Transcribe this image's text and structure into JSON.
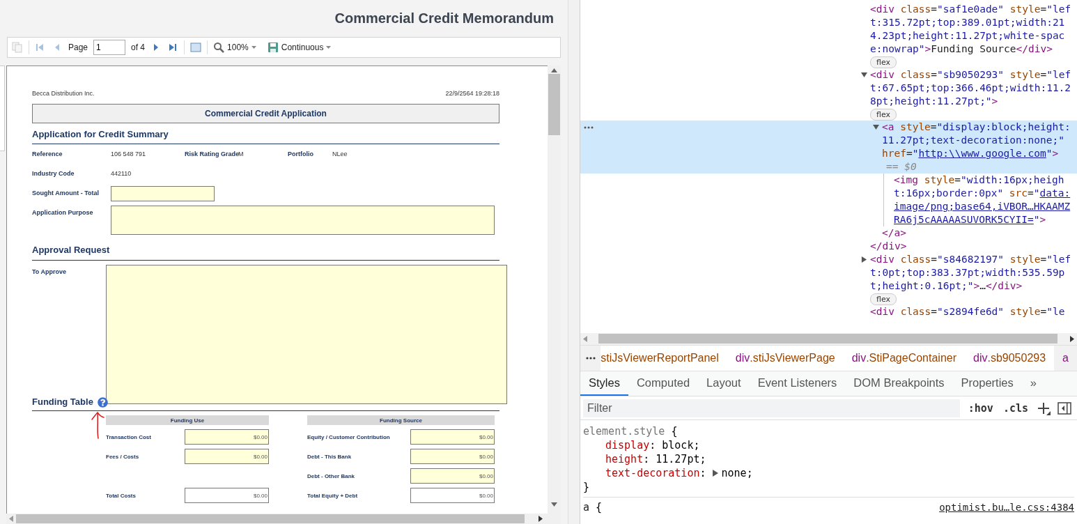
{
  "report_title": "Commercial Credit Memorandum",
  "viewer_toolbar": {
    "copy_disabled": true,
    "nav_back": [
      {
        "kind": "first",
        "disabled": true
      },
      {
        "kind": "prev",
        "disabled": true
      }
    ],
    "page_label": "Page",
    "page_value": "1",
    "page_count": "of 4",
    "nav_forward": [
      {
        "kind": "next",
        "disabled": false
      },
      {
        "kind": "last",
        "disabled": false
      }
    ],
    "zoom": "100%",
    "view_mode": "Continuous"
  },
  "report_page": {
    "company": "Becca Distribution Inc.",
    "timestamp": "22/9/2564 19:28:18",
    "band_title": "Commercial Credit Application",
    "summary": {
      "title": "Application for Credit Summary",
      "facts": [
        {
          "label": "Reference",
          "value": "106 548 791"
        },
        {
          "label": "Risk Rating Grade",
          "value": "M"
        },
        {
          "label": "Portfolio",
          "value": "NLee"
        },
        {
          "label": "Industry Code",
          "value": "442110"
        }
      ],
      "sought_label": "Sought Amount - Total",
      "purpose_label": "Application Purpose"
    },
    "approval": {
      "title": "Approval Request",
      "to_approve_label": "To Approve"
    },
    "funding": {
      "title": "Funding Table",
      "use": {
        "heading": "Funding Use",
        "rows": [
          {
            "kind": "input",
            "label": "Transaction Cost",
            "value": "$0.00"
          },
          {
            "kind": "input",
            "label": "Fees / Costs",
            "value": "$0.00"
          },
          {
            "kind": "total",
            "label": "Total Costs",
            "value": "$0.00"
          }
        ]
      },
      "source": {
        "heading": "Funding Source",
        "rows": [
          {
            "kind": "input",
            "label": "Equity / Customer Contribution",
            "value": "$0.00"
          },
          {
            "kind": "input",
            "label": "Debt - This Bank",
            "value": "$0.00"
          },
          {
            "kind": "input",
            "label": "Debt - Other Bank",
            "value": "$0.00"
          },
          {
            "kind": "total",
            "label": "Total Equity + Debt",
            "value": "$0.00"
          }
        ]
      }
    }
  },
  "dom_tree": [
    {
      "selected": false,
      "badge": "flex",
      "tokens": [
        {
          "t": "<div",
          "kind": "tag"
        },
        {
          "t": " class",
          "kind": "attr"
        },
        {
          "t": "=",
          "kind": "punct"
        },
        {
          "t": "\"saf1e0ade\"",
          "kind": "value"
        },
        {
          "t": " style",
          "kind": "attr"
        },
        {
          "t": "=",
          "kind": "punct"
        },
        {
          "t": "\"left:315.72pt;top:389.01pt;width:214.23pt;height:11.27pt;white-space:nowrap\"",
          "kind": "value"
        },
        {
          "t": ">",
          "kind": "tag"
        },
        {
          "t": "Funding Source",
          "kind": "text"
        },
        {
          "t": "</div>",
          "kind": "tag"
        }
      ]
    },
    {
      "selected": false,
      "expanded": true,
      "badge": "flex",
      "tokens": [
        {
          "t": "<div",
          "kind": "tag"
        },
        {
          "t": " class",
          "kind": "attr"
        },
        {
          "t": "=",
          "kind": "punct"
        },
        {
          "t": "\"sb9050293\"",
          "kind": "value"
        },
        {
          "t": " style",
          "kind": "attr"
        },
        {
          "t": "=",
          "kind": "punct"
        },
        {
          "t": "\"left:67.65pt;top:366.46pt;width:11.28pt;height:11.27pt;\"",
          "kind": "value"
        },
        {
          "t": ">",
          "kind": "tag"
        }
      ],
      "children": [
        {
          "selected": true,
          "expanded": true,
          "marker": "== $0",
          "tokens": [
            {
              "t": "<a",
              "kind": "tag"
            },
            {
              "t": " style",
              "kind": "attr"
            },
            {
              "t": "=",
              "kind": "punct"
            },
            {
              "t": "\"display:block;height:11.27pt;text-decoration:none;\"",
              "kind": "value"
            },
            {
              "t": " href",
              "kind": "attr"
            },
            {
              "t": "=",
              "kind": "punct"
            },
            {
              "t": "\"",
              "kind": "value"
            },
            {
              "t": "http:\\\\www.google.com",
              "kind": "link"
            },
            {
              "t": "\"",
              "kind": "value"
            },
            {
              "t": ">",
              "kind": "tag"
            }
          ],
          "children": [
            {
              "selected": false,
              "tokens": [
                {
                  "t": "<img",
                  "kind": "tag"
                },
                {
                  "t": " style",
                  "kind": "attr"
                },
                {
                  "t": "=",
                  "kind": "punct"
                },
                {
                  "t": "\"width:16px;height:16px;border:0px\"",
                  "kind": "value"
                },
                {
                  "t": " src",
                  "kind": "attr"
                },
                {
                  "t": "=",
                  "kind": "punct"
                },
                {
                  "t": "\"",
                  "kind": "value"
                },
                {
                  "t": "data:image/png;base64,iVBOR…HKAAMZRA6j5cAAAAASUVORK5CYII=",
                  "kind": "link"
                },
                {
                  "t": "\"",
                  "kind": "value"
                },
                {
                  "t": ">",
                  "kind": "tag"
                }
              ]
            }
          ],
          "closing": [
            {
              "t": "</a>",
              "kind": "tag"
            }
          ]
        }
      ],
      "closing": [
        {
          "t": "</div>",
          "kind": "tag"
        }
      ]
    },
    {
      "selected": false,
      "expanded": false,
      "badge": "flex",
      "tokens": [
        {
          "t": "<div",
          "kind": "tag"
        },
        {
          "t": " class",
          "kind": "attr"
        },
        {
          "t": "=",
          "kind": "punct"
        },
        {
          "t": "\"s84682197\"",
          "kind": "value"
        },
        {
          "t": " style",
          "kind": "attr"
        },
        {
          "t": "=",
          "kind": "punct"
        },
        {
          "t": "\"left:0pt;top:383.37pt;width:535.59pt;height:0.16pt;\"",
          "kind": "value"
        },
        {
          "t": ">",
          "kind": "tag"
        },
        {
          "t": "…",
          "kind": "text"
        },
        {
          "t": "</div>",
          "kind": "tag"
        }
      ]
    },
    {
      "selected": false,
      "tokens": [
        {
          "t": "<div",
          "kind": "tag"
        },
        {
          "t": " class",
          "kind": "attr"
        },
        {
          "t": "=",
          "kind": "punct"
        },
        {
          "t": "\"s2894fe6d\"",
          "kind": "value"
        },
        {
          "t": " style",
          "kind": "attr"
        },
        {
          "t": "=",
          "kind": "punct"
        },
        {
          "t": "\"le",
          "kind": "value"
        }
      ]
    }
  ],
  "breadcrumbs": [
    {
      "cls": "stiJsViewerReportPanel",
      "selected": false
    },
    {
      "tag": "div",
      "cls": ".stiJsViewerPage",
      "selected": false
    },
    {
      "tag": "div",
      "cls": ".StiPageContainer",
      "selected": false
    },
    {
      "tag": "div",
      "cls": ".sb9050293",
      "selected": false
    },
    {
      "tag": "a",
      "selected": true
    }
  ],
  "style_tabs": [
    {
      "label": "Styles",
      "selected": true
    },
    {
      "label": "Computed",
      "selected": false
    },
    {
      "label": "Layout",
      "selected": false
    },
    {
      "label": "Event Listeners",
      "selected": false
    },
    {
      "label": "DOM Breakpoints",
      "selected": false
    },
    {
      "label": "Properties",
      "selected": false
    }
  ],
  "tabs_overflow": "»",
  "filter": {
    "placeholder": "Filter",
    "hov": ":hov",
    "cls": ".cls"
  },
  "rules": [
    {
      "selector": "element.style",
      "kind": "inline",
      "open": "{",
      "close": "}",
      "properties": [
        {
          "name": "display",
          "colon": ":",
          "value": "block",
          "end": ";",
          "expandable": false
        },
        {
          "name": "height",
          "colon": ":",
          "value": "11.27pt",
          "end": ";",
          "expandable": false
        },
        {
          "name": "text-decoration",
          "colon": ":",
          "value": "none",
          "end": ";",
          "expandable": true
        }
      ]
    },
    {
      "selector": "a",
      "kind": "sheet",
      "open": "{",
      "source": "optimist.bu…le.css:4384"
    }
  ]
}
